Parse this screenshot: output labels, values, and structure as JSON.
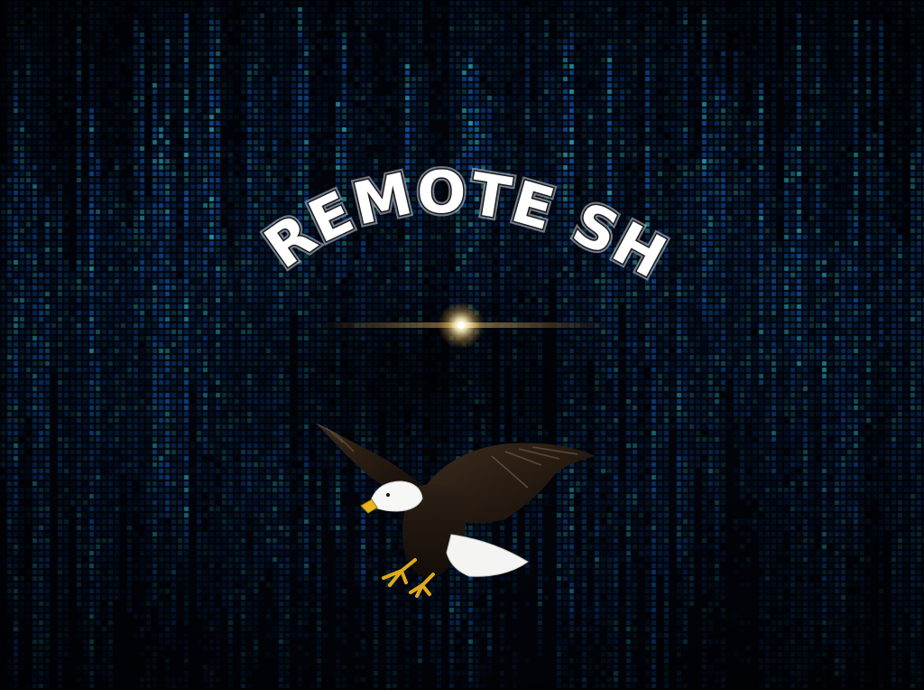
{
  "splash": {
    "title": "REMOTE SHELL"
  },
  "colors": {
    "background": "#02040a",
    "matrix_primary": "#1e6fb8",
    "matrix_highlight": "#3fb6c8",
    "flare": "#ffd98a",
    "title_fill": "#ffffff",
    "title_stroke": "#1a1a1a"
  },
  "icons": {
    "mascot": "bald-eagle-icon"
  }
}
